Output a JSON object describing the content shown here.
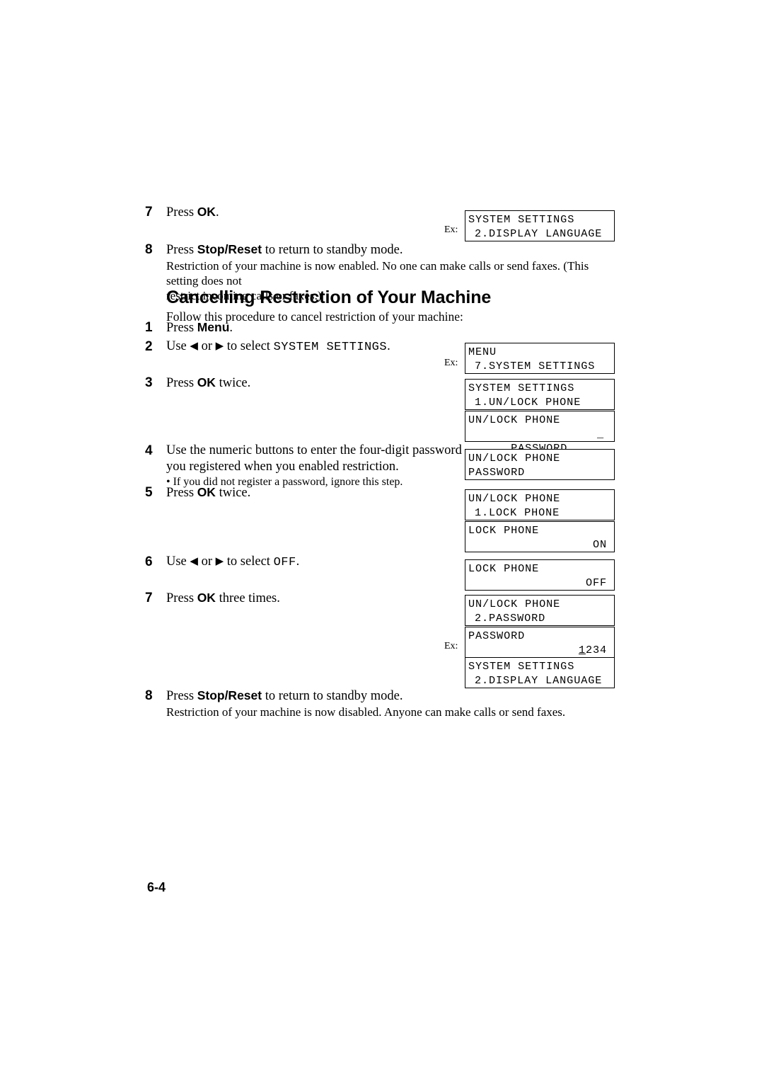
{
  "document": {
    "page_number": "6-4",
    "section_heading": "Cancelling Restriction of Your Machine",
    "section_intro": "Follow this procedure to cancel restriction of your machine:",
    "ex_label": "Ex:"
  },
  "top_steps": [
    {
      "number": "7",
      "text_before": "Press ",
      "key": "OK",
      "text_after": "."
    },
    {
      "number": "8",
      "text_before": "Press ",
      "key": "Stop/Reset",
      "text_after": " to return to standby mode.",
      "note_line1": "Restriction of your machine is now enabled. No one can make calls or send faxes. (This setting does not",
      "note_line2": "restrict incoming calls or faxes.)"
    }
  ],
  "cancel_steps": [
    {
      "number": "1",
      "text_before": "Press ",
      "key": "Menu",
      "text_after": "."
    },
    {
      "number": "2",
      "use_label": "Use",
      "left_arrow": "◀",
      "or_label": "or",
      "right_arrow": "▶",
      "select_label": "to select",
      "target": "SYSTEM SETTINGS",
      "period": "."
    },
    {
      "number": "3",
      "text_before": "Press ",
      "key": "OK",
      "text_after": " twice."
    },
    {
      "number": "4",
      "line1": "Use the numeric buttons to enter the four-digit password",
      "line2": "you registered when you enabled restriction.",
      "bullet": "• If you did not register a password, ignore this step."
    },
    {
      "number": "5",
      "text_before": "Press ",
      "key": "OK",
      "text_after": " twice."
    },
    {
      "number": "6",
      "use_label": "Use",
      "left_arrow": "◀",
      "or_label": "or",
      "right_arrow": "▶",
      "select_label": "to select",
      "target": "OFF",
      "period": "."
    },
    {
      "number": "7",
      "text_before": "Press ",
      "key": "OK",
      "text_after": " three times."
    },
    {
      "number": "8",
      "text_before": "Press ",
      "key": "Stop/Reset",
      "text_after": " to return to standby mode.",
      "note_line1": "Restriction of your machine is now disabled. Anyone can make calls or send faxes."
    }
  ],
  "lcd_screens": [
    {
      "id": "lcd-system-settings-display-language-top",
      "line1": "SYSTEM SETTINGS",
      "line2": "2.DISPLAY LANGUAGE",
      "has_ex": true
    },
    {
      "id": "lcd-menu-system-settings",
      "line1": "MENU",
      "line2": "7.SYSTEM SETTINGS",
      "has_ex": true
    },
    {
      "id": "lcd-system-settings-unlock-phone",
      "line1": "SYSTEM SETTINGS",
      "line2": "1.UN/LOCK PHONE",
      "has_ex": false
    },
    {
      "id": "lcd-unlock-phone-password-cursor",
      "line1": "UN/LOCK PHONE",
      "line2": "PASSWORD",
      "line2_right": "_",
      "has_ex": false
    },
    {
      "id": "lcd-unlock-phone-password",
      "line1": "UN/LOCK PHONE",
      "line2": "PASSWORD",
      "has_ex": false
    },
    {
      "id": "lcd-unlock-phone-lock-phone",
      "line1": "UN/LOCK PHONE",
      "line2": "1.LOCK PHONE",
      "has_ex": false
    },
    {
      "id": "lcd-lock-phone-on",
      "line1": "LOCK PHONE",
      "line2_right": "ON",
      "has_ex": false
    },
    {
      "id": "lcd-lock-phone-off",
      "line1": "LOCK PHONE",
      "line2_right": "OFF",
      "has_ex": false
    },
    {
      "id": "lcd-unlock-phone-password-menu",
      "line1": "UN/LOCK PHONE",
      "line2": "2.PASSWORD",
      "has_ex": false
    },
    {
      "id": "lcd-password-1234",
      "line1": "PASSWORD",
      "cursor_digit": "1",
      "rest_digits": "234",
      "has_ex": true
    },
    {
      "id": "lcd-system-settings-display-language-bottom",
      "line1": "SYSTEM SETTINGS",
      "line2": "2.DISPLAY LANGUAGE",
      "has_ex": false
    }
  ]
}
